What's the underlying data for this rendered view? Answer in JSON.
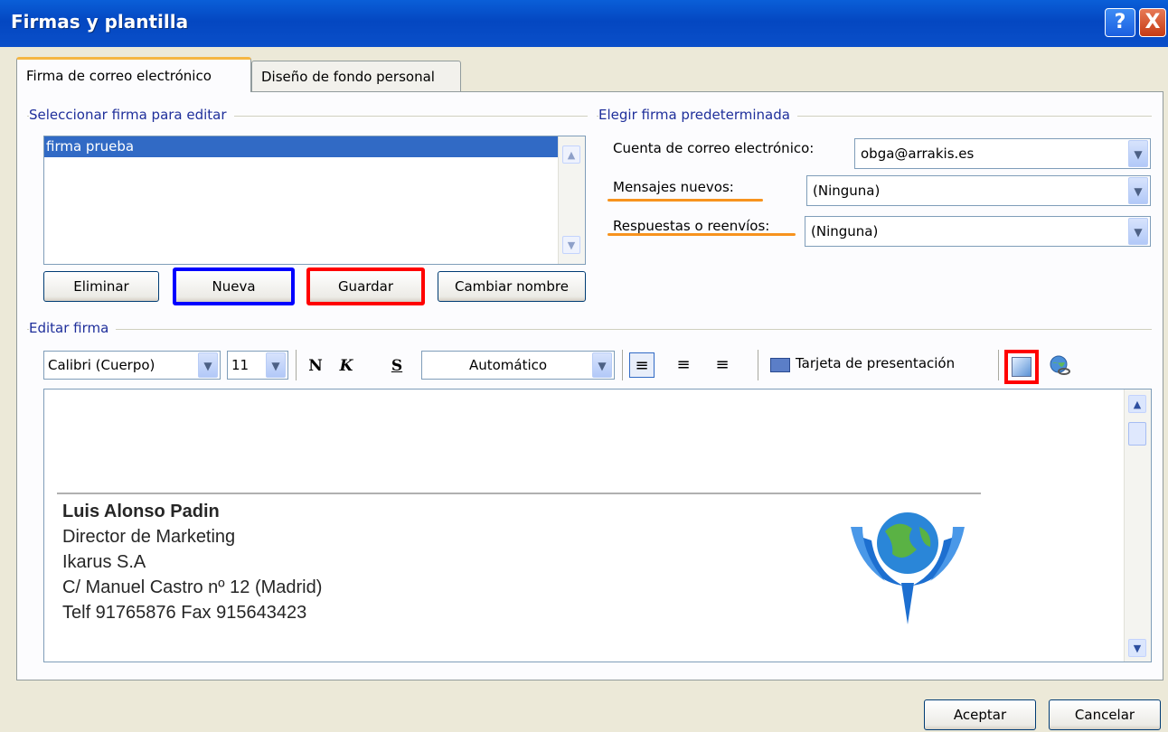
{
  "window": {
    "title": "Firmas y plantilla",
    "help_glyph": "?",
    "close_glyph": "X"
  },
  "tabs": [
    {
      "label": "Firma de correo electrónico",
      "active": true
    },
    {
      "label": "Diseño de fondo personal",
      "active": false
    }
  ],
  "select_section": {
    "label": "Seleccionar firma para editar",
    "items": [
      "firma prueba"
    ],
    "buttons": {
      "delete": "Eliminar",
      "new": "Nueva",
      "save": "Guardar",
      "rename": "Cambiar nombre"
    }
  },
  "default_section": {
    "label": "Elegir firma predeterminada",
    "account_label": "Cuenta de correo electrónico:",
    "account_value": "obga@arrakis.es",
    "new_messages_label": "Mensajes nuevos:",
    "new_messages_value": "(Ninguna)",
    "replies_label": "Respuestas o reenvíos:",
    "replies_value": "(Ninguna)"
  },
  "edit_section": {
    "label": "Editar firma",
    "font": "Calibri (Cuerpo)",
    "size": "11",
    "bold": "N",
    "italic": "K",
    "underline": "S",
    "color": "Automático",
    "business_card": "Tarjeta de presentación"
  },
  "signature": {
    "name": "Luis Alonso Padin",
    "role": "Director de Marketing",
    "company": "Ikarus S.A",
    "address": "C/ Manuel Castro nº 12 (Madrid)",
    "phone": "Telf 91765876  Fax 915643423"
  },
  "footer": {
    "ok": "Aceptar",
    "cancel": "Cancelar"
  },
  "colors": {
    "titlebar": "#0447c1",
    "highlight_blue": "#0000ff",
    "highlight_red": "#ff0000",
    "underline_orange": "#f7931e",
    "selection": "#316ac5"
  }
}
